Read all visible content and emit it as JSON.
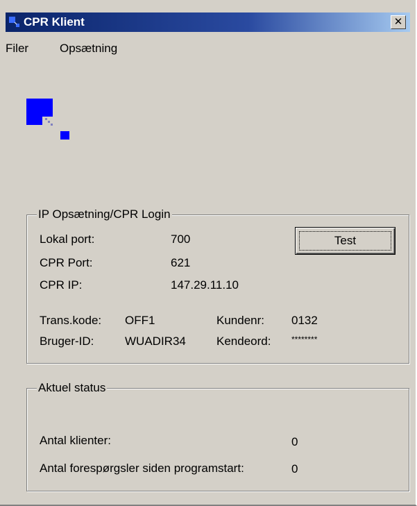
{
  "window": {
    "title": "CPR Klient",
    "close_glyph": "✕",
    "title_icon": "app-icon"
  },
  "menu": {
    "items": [
      {
        "label": "Filer"
      },
      {
        "label": "Opsætning"
      }
    ]
  },
  "logo": {
    "icon": "app-logo-icon",
    "color": "#0000ff"
  },
  "ip_group": {
    "legend": "IP Opsætning/CPR Login",
    "lokal_port_label": "Lokal port:",
    "lokal_port_value": "700",
    "cpr_port_label": "CPR Port:",
    "cpr_port_value": "621",
    "cpr_ip_label": "CPR IP:",
    "cpr_ip_value": "147.29.11.10",
    "trans_kode_label": "Trans.kode:",
    "trans_kode_value": "OFF1",
    "kundenr_label": "Kundenr:",
    "kundenr_value": "0132",
    "bruger_id_label": "Bruger-ID:",
    "bruger_id_value": "WUADIR34",
    "kendeord_label": "Kendeord:",
    "kendeord_value": "********",
    "test_button_label": "Test"
  },
  "status_group": {
    "legend": "Aktuel status",
    "antal_klienter_label": "Antal klienter:",
    "antal_klienter_value": "0",
    "antal_forespoergsler_label": "Antal forespørgsler siden programstart:",
    "antal_forespoergsler_value": "0"
  },
  "colors": {
    "title_bar": "#0a246a",
    "window_face": "#d4d0c8"
  }
}
